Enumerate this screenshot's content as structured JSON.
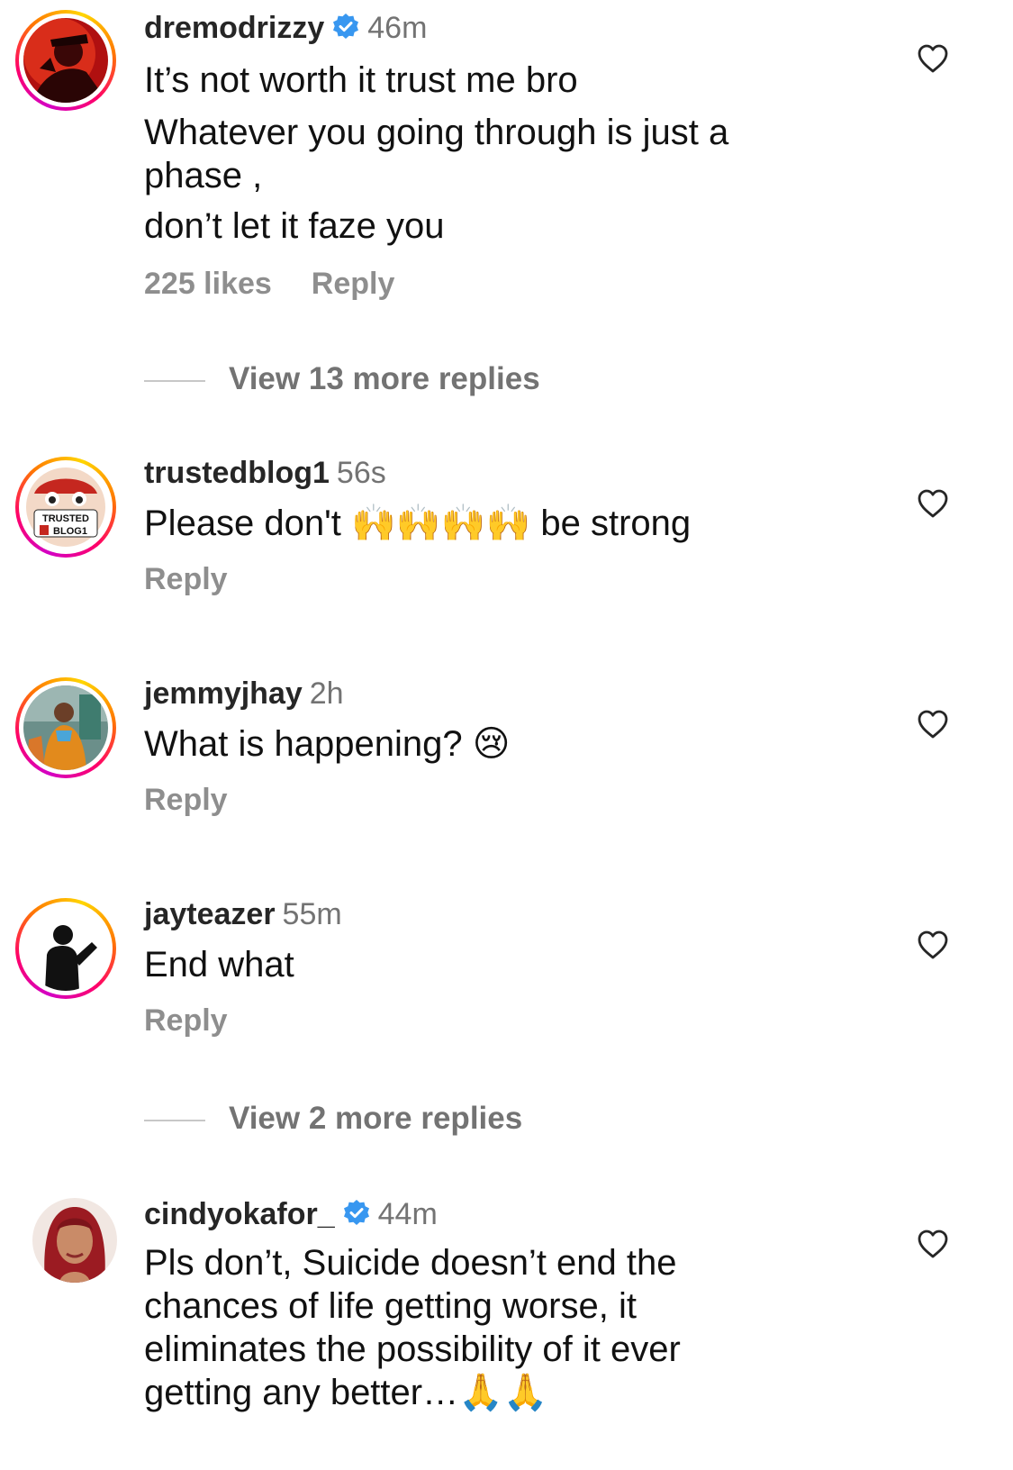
{
  "comments": [
    {
      "username": "dremodrizzy",
      "verified": true,
      "time": "46m",
      "lines": [
        "It’s not worth it trust me bro",
        "Whatever you going through is just a",
        "phase ,",
        "don’t let it faze you"
      ],
      "likes": "225 likes",
      "reply": "Reply",
      "view_more": "View 13 more replies"
    },
    {
      "username": "trustedblog1",
      "verified": false,
      "time": "56s",
      "text_before": "Please don't",
      "emojis": "🙌🙌🙌🙌",
      "text_after": "be strong",
      "reply": "Reply",
      "avatar_text_1": "TRUSTED",
      "avatar_text_2": "BLOG1"
    },
    {
      "username": "jemmyjhay",
      "verified": false,
      "time": "2h",
      "text": "What is happening?",
      "emoji": "😢",
      "reply": "Reply"
    },
    {
      "username": "jayteazer",
      "verified": false,
      "time": "55m",
      "text": "End what",
      "reply": "Reply",
      "view_more": "View 2 more replies"
    },
    {
      "username": "cindyokafor_",
      "verified": true,
      "time": "44m",
      "lines": [
        "Pls don’t, Suicide doesn’t end the",
        "chances of life getting worse, it",
        "eliminates the possibility of it ever",
        "getting any better…"
      ],
      "emojis": "🙏🙏"
    }
  ],
  "icons": {
    "like": "heart-outline-icon",
    "verified": "verified-badge-icon"
  },
  "colors": {
    "verified_blue": "#3897f0",
    "secondary_text": "#737373",
    "meta_text": "#8e8e8e",
    "primary_text": "#111111"
  }
}
